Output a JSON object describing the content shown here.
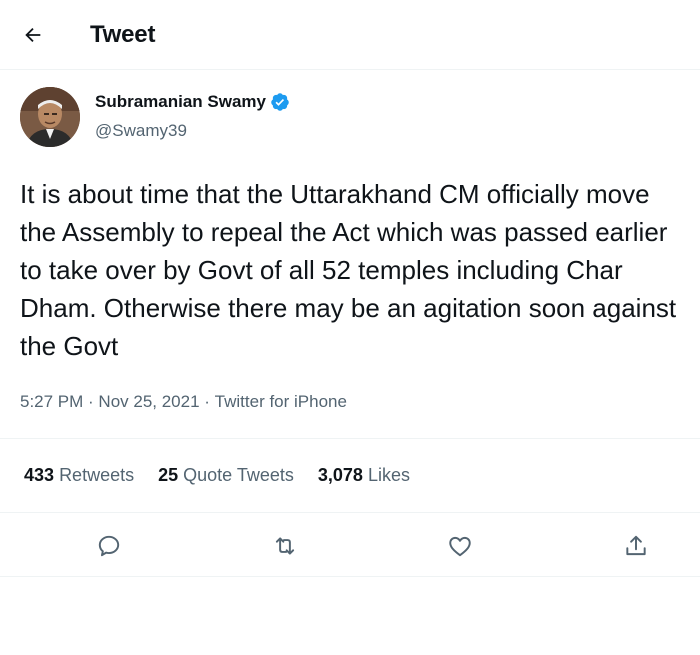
{
  "header": {
    "title": "Tweet",
    "back_icon": "back-arrow-icon"
  },
  "author": {
    "name": "Subramanian Swamy",
    "handle": "@Swamy39",
    "verified": true,
    "verified_color": "#1d9bf0"
  },
  "tweet": {
    "text": "It is about time that the Uttarakhand CM officially move the Assembly to repeal the Act which was passed earlier to take over by Govt of all 52 temples including Char Dham. Otherwise there may be an agitation soon against the Govt",
    "time": "5:27 PM",
    "date": "Nov 25, 2021",
    "source": "Twitter for iPhone",
    "separator": " · "
  },
  "stats": [
    {
      "count": "433",
      "label": "Retweets"
    },
    {
      "count": "25",
      "label": "Quote Tweets"
    },
    {
      "count": "3,078",
      "label": "Likes"
    }
  ],
  "actions": [
    "reply-icon",
    "retweet-icon",
    "like-icon",
    "share-icon"
  ],
  "colors": {
    "text": "#0f1419",
    "secondary": "#536471",
    "divider": "#eff3f4"
  }
}
